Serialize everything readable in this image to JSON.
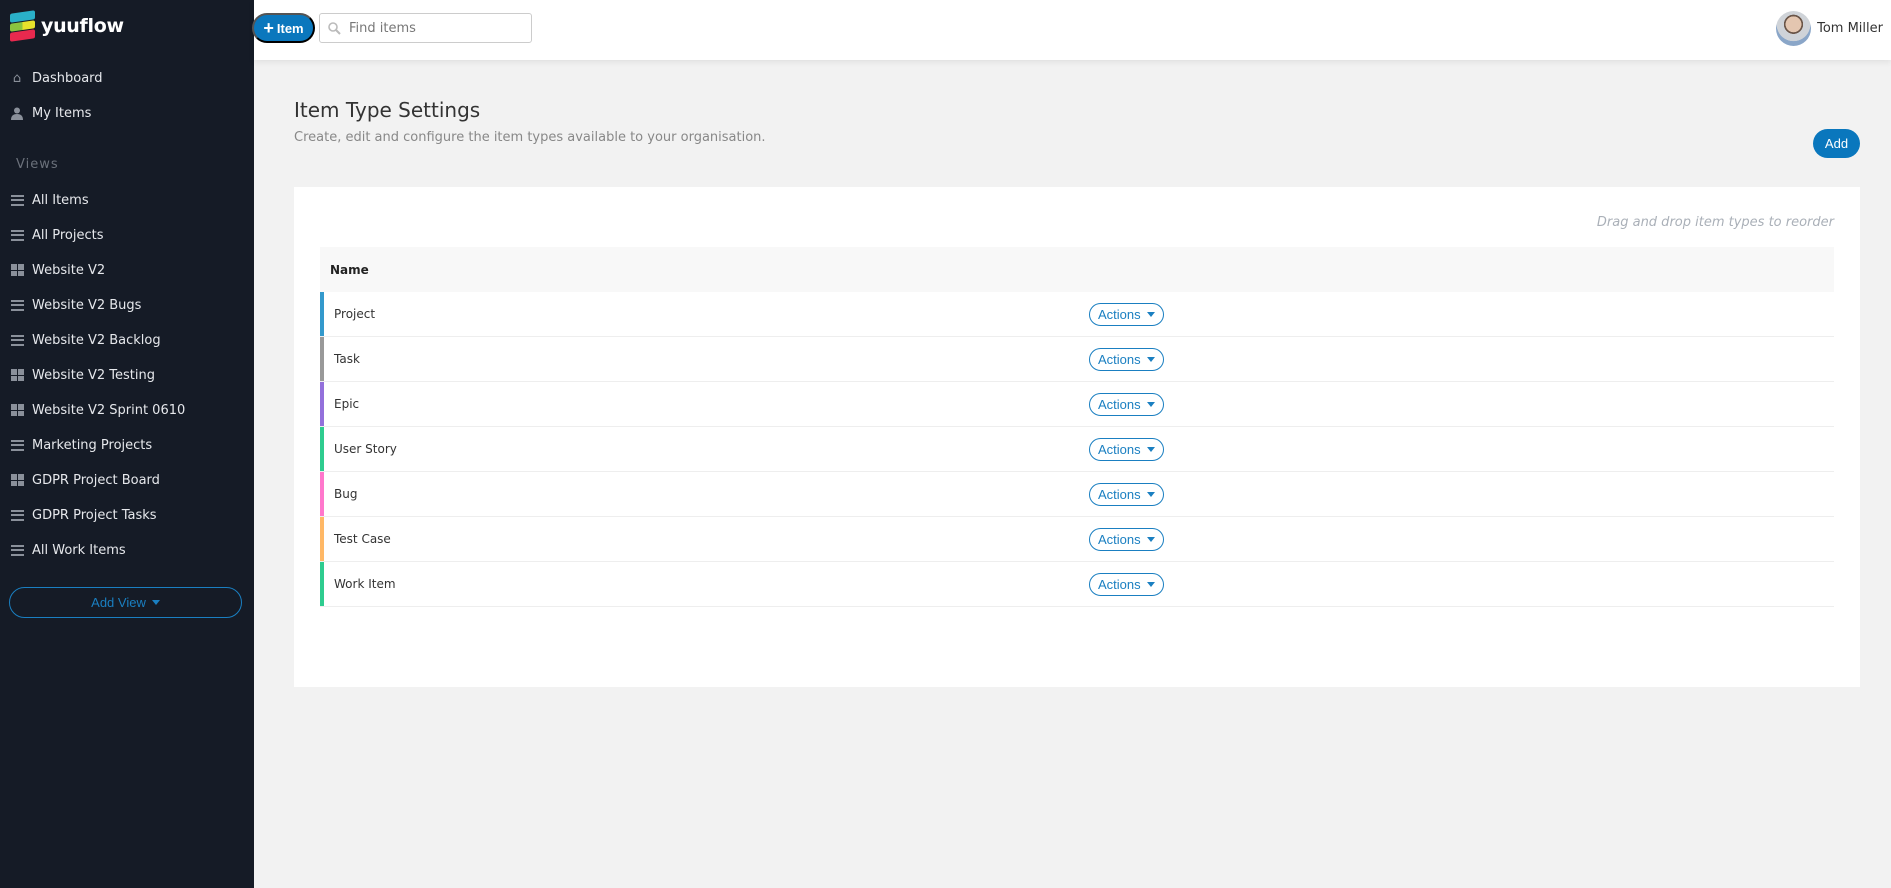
{
  "brand": {
    "name": "yuuflow",
    "colors": [
      "#2ab0c8",
      "#8bc43f",
      "#e8e22b",
      "#e8294e"
    ]
  },
  "sidebar": {
    "main": [
      {
        "label": "Dashboard",
        "icon": "home-icon"
      },
      {
        "label": "My Items",
        "icon": "user-icon"
      }
    ],
    "views_label": "Views",
    "views": [
      {
        "label": "All Items",
        "icon": "list"
      },
      {
        "label": "All Projects",
        "icon": "list"
      },
      {
        "label": "Website V2",
        "icon": "grid"
      },
      {
        "label": "Website V2 Bugs",
        "icon": "list"
      },
      {
        "label": "Website V2 Backlog",
        "icon": "list"
      },
      {
        "label": "Website V2 Testing",
        "icon": "grid"
      },
      {
        "label": "Website V2 Sprint 0610",
        "icon": "grid"
      },
      {
        "label": "Marketing Projects",
        "icon": "list"
      },
      {
        "label": "GDPR Project Board",
        "icon": "grid"
      },
      {
        "label": "GDPR Project Tasks",
        "icon": "list"
      },
      {
        "label": "All Work Items",
        "icon": "list"
      }
    ],
    "add_view": "Add View"
  },
  "topbar": {
    "new_item": "Item",
    "search_placeholder": "Find items",
    "user_name": "Tom Miller"
  },
  "page": {
    "title": "Item Type Settings",
    "subtitle": "Create, edit and configure the item types available to your organisation.",
    "add_label": "Add",
    "hint": "Drag and drop item types to reorder"
  },
  "table": {
    "header": "Name",
    "actions_label": "Actions",
    "rows": [
      {
        "name": "Project",
        "color": "#3399cc"
      },
      {
        "name": "Task",
        "color": "#999999"
      },
      {
        "name": "Epic",
        "color": "#9370db"
      },
      {
        "name": "User Story",
        "color": "#2ecc8f"
      },
      {
        "name": "Bug",
        "color": "#ff77cc"
      },
      {
        "name": "Test Case",
        "color": "#ffb866"
      },
      {
        "name": "Work Item",
        "color": "#2ecc8f"
      }
    ]
  }
}
